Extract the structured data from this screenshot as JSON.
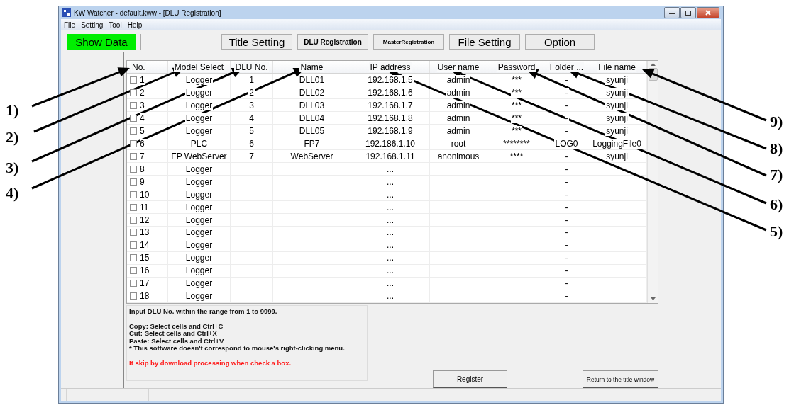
{
  "window": {
    "title": "KW Watcher - default.kww - [DLU Registration]"
  },
  "menu": [
    "File",
    "Setting",
    "Tool",
    "Help"
  ],
  "toolbar": [
    {
      "label": "Show Data",
      "kind": "status"
    },
    {
      "label": "Title Setting",
      "kind": "large"
    },
    {
      "label": "DLU Registration",
      "kind": "bold"
    },
    {
      "label": "MasterRegistration",
      "kind": "small"
    },
    {
      "label": "File Setting",
      "kind": "large"
    },
    {
      "label": "Option",
      "kind": "large"
    }
  ],
  "table": {
    "columns": [
      "No.",
      "Model Select",
      "DLU No.",
      "Name",
      "IP address",
      "User name",
      "Password",
      "Folder ...",
      "File name"
    ],
    "rows": [
      {
        "checked": false,
        "cells": [
          "1",
          "Logger",
          "1",
          "DLL01",
          "192.168.1.5",
          "admin",
          "***",
          "-",
          "syunji"
        ]
      },
      {
        "checked": false,
        "cells": [
          "2",
          "Logger",
          "2",
          "DLL02",
          "192.168.1.6",
          "admin",
          "***",
          "-",
          "syunji"
        ]
      },
      {
        "checked": false,
        "cells": [
          "3",
          "Logger",
          "3",
          "DLL03",
          "192.168.1.7",
          "admin",
          "***",
          "-",
          "syunji"
        ]
      },
      {
        "checked": false,
        "cells": [
          "4",
          "Logger",
          "4",
          "DLL04",
          "192.168.1.8",
          "admin",
          "***",
          "-",
          "syunji"
        ]
      },
      {
        "checked": false,
        "cells": [
          "5",
          "Logger",
          "5",
          "DLL05",
          "192.168.1.9",
          "admin",
          "***",
          "-",
          "syunji"
        ]
      },
      {
        "checked": false,
        "cells": [
          "6",
          "PLC",
          "6",
          "FP7",
          "192.186.1.10",
          "root",
          "********",
          "LOG0",
          "LoggingFile0"
        ]
      },
      {
        "checked": false,
        "cells": [
          "7",
          "FP WebServer",
          "7",
          "WebServer",
          "192.168.1.11",
          "anonimous",
          "****",
          "-",
          "syunji"
        ]
      },
      {
        "checked": false,
        "cells": [
          "8",
          "Logger",
          "",
          "",
          "...",
          "",
          "",
          "-",
          ""
        ]
      },
      {
        "checked": false,
        "cells": [
          "9",
          "Logger",
          "",
          "",
          "...",
          "",
          "",
          "-",
          ""
        ]
      },
      {
        "checked": false,
        "cells": [
          "10",
          "Logger",
          "",
          "",
          "...",
          "",
          "",
          "-",
          ""
        ]
      },
      {
        "checked": false,
        "cells": [
          "11",
          "Logger",
          "",
          "",
          "...",
          "",
          "",
          "-",
          ""
        ]
      },
      {
        "checked": false,
        "cells": [
          "12",
          "Logger",
          "",
          "",
          "...",
          "",
          "",
          "-",
          ""
        ]
      },
      {
        "checked": false,
        "cells": [
          "13",
          "Logger",
          "",
          "",
          "...",
          "",
          "",
          "-",
          ""
        ]
      },
      {
        "checked": false,
        "cells": [
          "14",
          "Logger",
          "",
          "",
          "...",
          "",
          "",
          "-",
          ""
        ]
      },
      {
        "checked": false,
        "cells": [
          "15",
          "Logger",
          "",
          "",
          "...",
          "",
          "",
          "-",
          ""
        ]
      },
      {
        "checked": false,
        "cells": [
          "16",
          "Logger",
          "",
          "",
          "...",
          "",
          "",
          "-",
          ""
        ]
      },
      {
        "checked": false,
        "cells": [
          "17",
          "Logger",
          "",
          "",
          "...",
          "",
          "",
          "-",
          ""
        ]
      },
      {
        "checked": false,
        "cells": [
          "18",
          "Logger",
          "",
          "",
          "...",
          "",
          "",
          "-",
          ""
        ]
      }
    ]
  },
  "info": [
    {
      "kind": "note",
      "lines": [
        "Input DLU No. within the range from 1 to 9999."
      ]
    },
    {
      "kind": "note",
      "lines": [
        "Copy: Select cells and Ctrl+C",
        "Cut: Select cells and Ctrl+X",
        "Paste: Select cells and Ctrl+V",
        "* This software doesn't correspond to mouse's right-clicking menu."
      ]
    },
    {
      "kind": "warning",
      "lines": [
        "It skip by download processing when check a box."
      ]
    }
  ],
  "buttons": [
    "Register",
    "Return to the title window"
  ],
  "callouts": [
    "1)",
    "2)",
    "3)",
    "4)",
    "9)",
    "8)",
    "7)",
    "6)",
    "5)"
  ]
}
